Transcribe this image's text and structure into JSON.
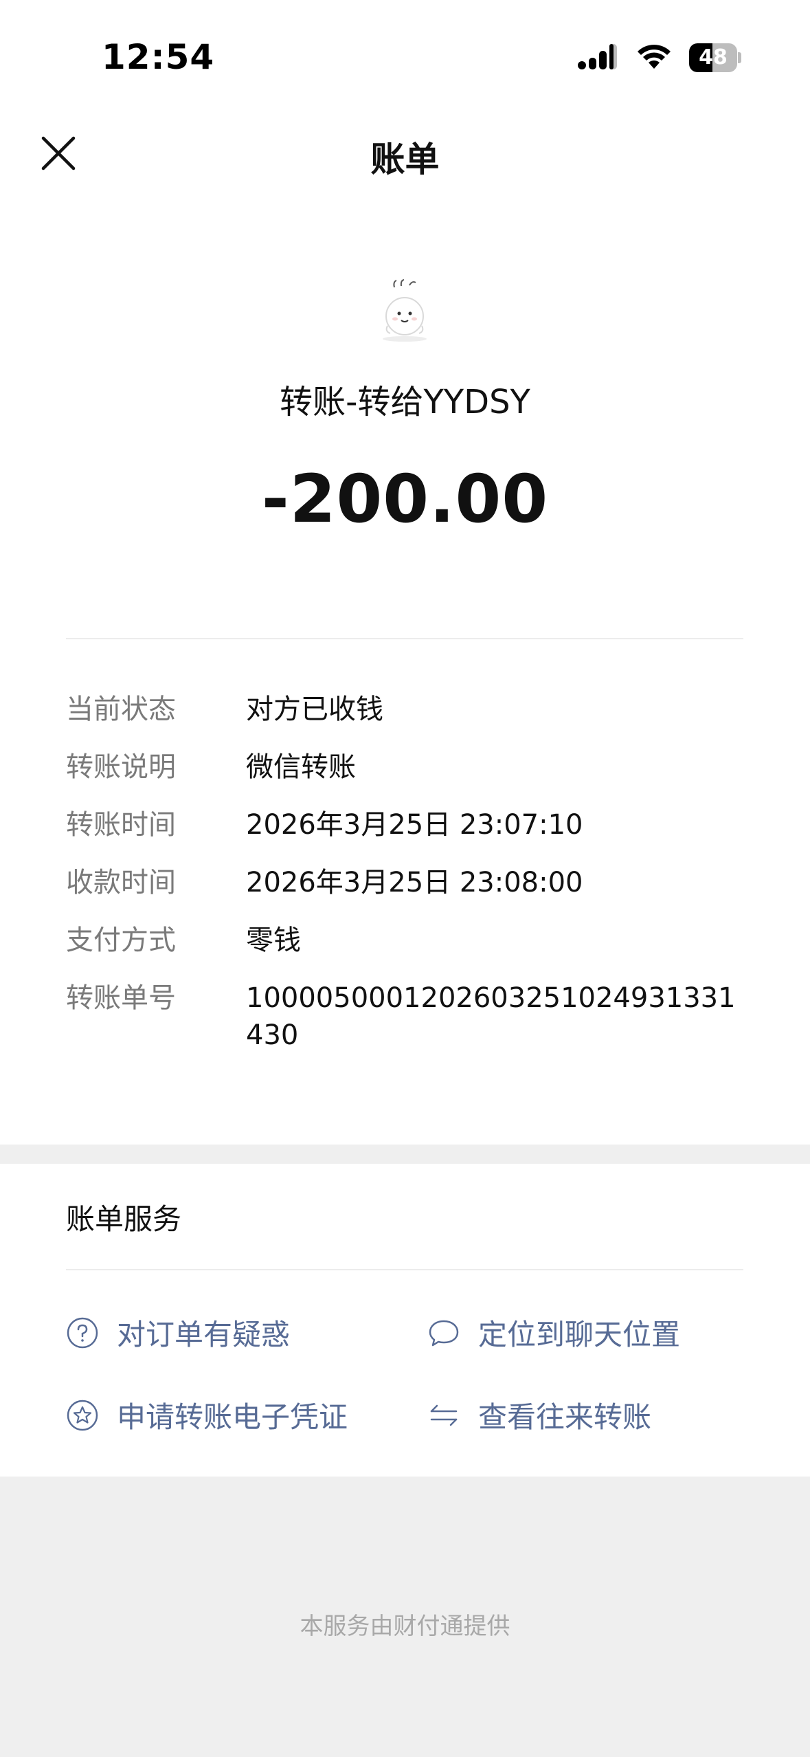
{
  "status_bar": {
    "time": "12:54",
    "battery": "48",
    "battery_level": 0.48,
    "icons": [
      "cellular-signal-icon",
      "wifi-icon",
      "battery-icon"
    ]
  },
  "nav": {
    "title": "账单",
    "close_icon": "close-icon"
  },
  "header": {
    "avatar_icon": "avatar-image",
    "title": "转账-转给YYDSY",
    "amount": "-200.00"
  },
  "details": [
    {
      "label": "当前状态",
      "value": "对方已收钱"
    },
    {
      "label": "转账说明",
      "value": "微信转账"
    },
    {
      "label": "转账时间",
      "value": "2026年3月25日 23:07:10"
    },
    {
      "label": "收款时间",
      "value": "2026年3月25日 23:08:00"
    },
    {
      "label": "支付方式",
      "value": "零钱"
    },
    {
      "label": "转账单号",
      "value": "100005000120260325102493133143​0"
    }
  ],
  "services": {
    "title": "账单服务",
    "items": [
      {
        "label": "对订单有疑惑",
        "icon": "question-circle-icon"
      },
      {
        "label": "定位到聊天位置",
        "icon": "chat-bubble-icon"
      },
      {
        "label": "申请转账电子凭证",
        "icon": "star-badge-icon"
      },
      {
        "label": "查看往来转账",
        "icon": "transfer-arrows-icon"
      }
    ]
  },
  "footer": {
    "text": "本服务由财付通提供"
  },
  "colors": {
    "link": "#576b95",
    "label": "#7a7a7a",
    "background_band": "#efefef"
  }
}
